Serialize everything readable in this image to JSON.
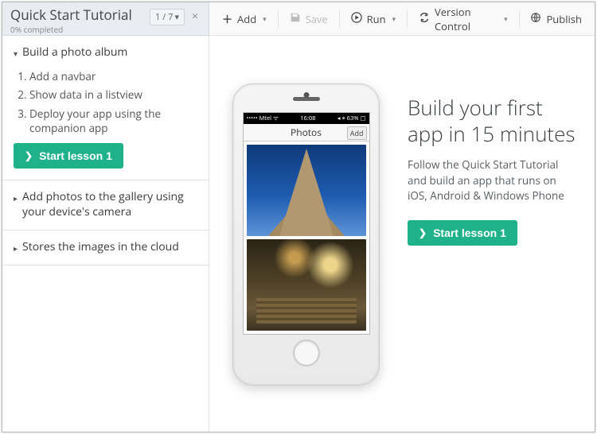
{
  "tutorial": {
    "title": "Quick Start Tutorial",
    "completed": "0% completed",
    "pager": "1 / 7",
    "sections": [
      {
        "title": "Build a photo album",
        "expanded": true,
        "steps": [
          "Add a navbar",
          "Show data in a listview",
          "Deploy your app using the companion app"
        ],
        "button": "Start lesson 1"
      },
      {
        "title": "Add photos to the gallery using your device's camera",
        "expanded": false
      },
      {
        "title": "Stores the images in the cloud",
        "expanded": false
      }
    ]
  },
  "toolbar": {
    "add": "Add",
    "save": "Save",
    "run": "Run",
    "version_control": "Version Control",
    "publish": "Publish"
  },
  "promo": {
    "headline": "Build your first app in 15 minutes",
    "body": "Follow the Quick Start Tutorial and build an app that runs on iOS, Android & Windows Phone",
    "button": "Start lesson 1"
  },
  "phone": {
    "status_left": "••••• Mtel ᯤ",
    "status_time": "16:08",
    "status_right": "◂ ⌖ 63% ▢",
    "nav_title": "Photos",
    "nav_button": "Add"
  }
}
